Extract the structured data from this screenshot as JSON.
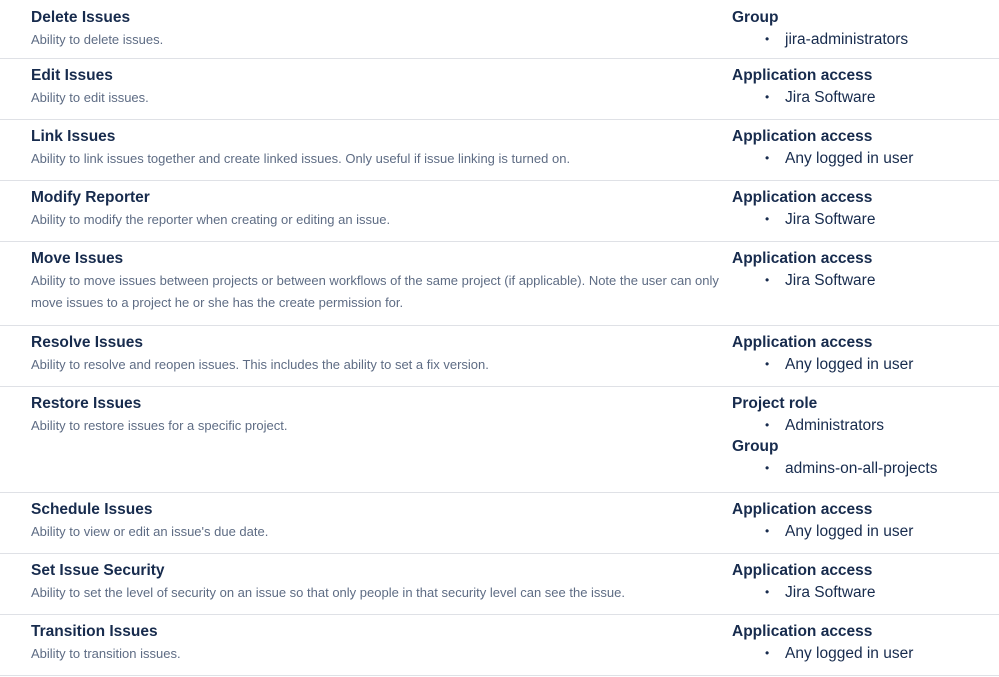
{
  "permissions": [
    {
      "name": "Delete Issues",
      "description": "Ability to delete issues.",
      "grants": [
        {
          "type": "Group",
          "items": [
            "jira-administrators"
          ]
        }
      ]
    },
    {
      "name": "Edit Issues",
      "description": "Ability to edit issues.",
      "grants": [
        {
          "type": "Application access",
          "items": [
            "Jira Software"
          ]
        }
      ]
    },
    {
      "name": "Link Issues",
      "description": "Ability to link issues together and create linked issues. Only useful if issue linking is turned on.",
      "grants": [
        {
          "type": "Application access",
          "items": [
            "Any logged in user"
          ]
        }
      ]
    },
    {
      "name": "Modify Reporter",
      "description": "Ability to modify the reporter when creating or editing an issue.",
      "grants": [
        {
          "type": "Application access",
          "items": [
            "Jira Software"
          ]
        }
      ]
    },
    {
      "name": "Move Issues",
      "description": "Ability to move issues between projects or between workflows of the same project (if applicable). Note the user can only move issues to a project he or she has the create permission for.",
      "grants": [
        {
          "type": "Application access",
          "items": [
            "Jira Software"
          ]
        }
      ]
    },
    {
      "name": "Resolve Issues",
      "description": "Ability to resolve and reopen issues. This includes the ability to set a fix version.",
      "grants": [
        {
          "type": "Application access",
          "items": [
            "Any logged in user"
          ]
        }
      ]
    },
    {
      "name": "Restore Issues",
      "description": "Ability to restore issues for a specific project.",
      "grants": [
        {
          "type": "Project role",
          "items": [
            "Administrators"
          ]
        },
        {
          "type": "Group",
          "items": [
            "admins-on-all-projects"
          ]
        }
      ]
    },
    {
      "name": "Schedule Issues",
      "description": "Ability to view or edit an issue's due date.",
      "grants": [
        {
          "type": "Application access",
          "items": [
            "Any logged in user"
          ]
        }
      ]
    },
    {
      "name": "Set Issue Security",
      "description": "Ability to set the level of security on an issue so that only people in that security level can see the issue.",
      "grants": [
        {
          "type": "Application access",
          "items": [
            "Jira Software"
          ]
        }
      ]
    },
    {
      "name": "Transition Issues",
      "description": "Ability to transition issues.",
      "grants": [
        {
          "type": "Application access",
          "items": [
            "Any logged in user"
          ]
        }
      ]
    }
  ],
  "bullet_glyph": "•"
}
